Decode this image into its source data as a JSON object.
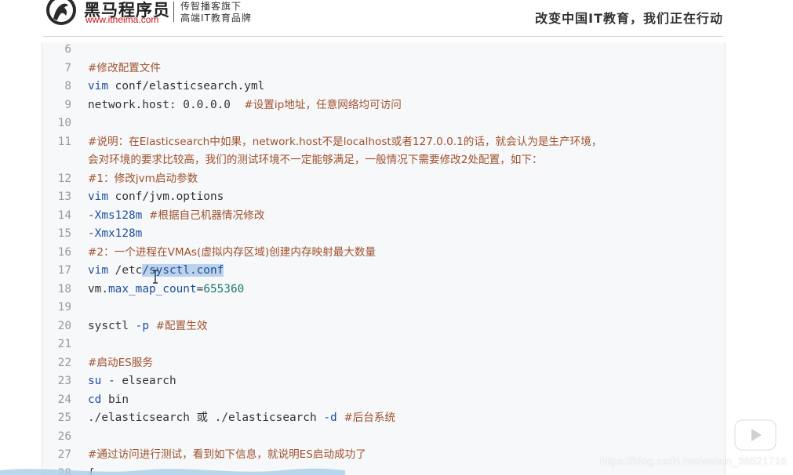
{
  "header": {
    "brand_name": "黑马程序员",
    "brand_url": "www.itheima.com",
    "tagline_1": "传智播客旗下",
    "tagline_2": "高端IT教育品牌",
    "slogan": "改变中国IT教育，我们正在行动"
  },
  "code": {
    "lines": [
      {
        "n": "6",
        "parts": []
      },
      {
        "n": "7",
        "parts": [
          {
            "t": "#修改配置文件",
            "c": "cmt"
          }
        ]
      },
      {
        "n": "8",
        "parts": [
          {
            "t": "vim",
            "c": "kw"
          },
          {
            "t": " conf/elasticsearch.yml",
            "c": "plain"
          }
        ]
      },
      {
        "n": "9",
        "parts": [
          {
            "t": "network.host: 0.0.0.0  ",
            "c": "plain"
          },
          {
            "t": "#设置ip地址，任意网络均可访问",
            "c": "cmt"
          }
        ]
      },
      {
        "n": "10",
        "parts": []
      },
      {
        "n": "11",
        "parts": [
          {
            "t": "#说明：在Elasticsearch中如果，network.host不是localhost或者127.0.0.1的话，就会认为是生产环境，",
            "c": "cmt"
          }
        ]
      },
      {
        "n": "",
        "parts": [
          {
            "t": "会对环境的要求比较高，我们的测试环境不一定能够满足，一般情况下需要修改2处配置，如下：",
            "c": "cmt"
          }
        ]
      },
      {
        "n": "12",
        "parts": [
          {
            "t": "#1：修改jvm启动参数",
            "c": "cmt"
          }
        ]
      },
      {
        "n": "13",
        "parts": [
          {
            "t": "vim",
            "c": "kw"
          },
          {
            "t": " conf/jvm.options",
            "c": "plain"
          }
        ]
      },
      {
        "n": "14",
        "parts": [
          {
            "t": "-Xms128m",
            "c": "kw"
          },
          {
            "t": " ",
            "c": "plain"
          },
          {
            "t": "#根据自己机器情况修改",
            "c": "cmt"
          }
        ]
      },
      {
        "n": "15",
        "parts": [
          {
            "t": "-Xmx128m",
            "c": "kw"
          }
        ]
      },
      {
        "n": "16",
        "parts": [
          {
            "t": "#2：一个进程在VMAs(虚拟内存区域)创建内存映射最大数量",
            "c": "cmt"
          }
        ]
      },
      {
        "n": "17",
        "parts": [
          {
            "t": "vim",
            "c": "kw"
          },
          {
            "t": " /etc",
            "c": "plain"
          },
          {
            "t": "/sysctl.conf",
            "c": "sel"
          }
        ]
      },
      {
        "n": "18",
        "parts": [
          {
            "t": "vm.",
            "c": "plain"
          },
          {
            "t": "max_map_count",
            "c": "kw"
          },
          {
            "t": "=",
            "c": "plain"
          },
          {
            "t": "655360",
            "c": "num"
          }
        ]
      },
      {
        "n": "19",
        "parts": []
      },
      {
        "n": "20",
        "parts": [
          {
            "t": "sysctl ",
            "c": "plain"
          },
          {
            "t": "-p",
            "c": "kw"
          },
          {
            "t": " ",
            "c": "plain"
          },
          {
            "t": "#配置生效",
            "c": "cmt"
          }
        ]
      },
      {
        "n": "21",
        "parts": []
      },
      {
        "n": "22",
        "parts": [
          {
            "t": "#启动ES服务",
            "c": "cmt"
          }
        ]
      },
      {
        "n": "23",
        "parts": [
          {
            "t": "su",
            "c": "kw"
          },
          {
            "t": " - elsearch",
            "c": "plain"
          }
        ]
      },
      {
        "n": "24",
        "parts": [
          {
            "t": "cd",
            "c": "kw"
          },
          {
            "t": " bin",
            "c": "plain"
          }
        ]
      },
      {
        "n": "25",
        "parts": [
          {
            "t": "./elasticsearch 或 ./elasticsearch ",
            "c": "plain"
          },
          {
            "t": "-d",
            "c": "kw"
          },
          {
            "t": " ",
            "c": "plain"
          },
          {
            "t": "#后台系统",
            "c": "cmt"
          }
        ]
      },
      {
        "n": "26",
        "parts": []
      },
      {
        "n": "27",
        "parts": [
          {
            "t": "#通过访问进行测试，看到如下信息，就说明ES启动成功了",
            "c": "cmt"
          }
        ]
      },
      {
        "n": "28",
        "parts": [
          {
            "t": "{",
            "c": "plain"
          }
        ]
      }
    ]
  },
  "watermark": "https://blog.csdn.net/weixin_36521716",
  "icons": {
    "logo": "horse-logo-icon",
    "tv": "bilibili-tv-icon",
    "cursor": "text-cursor-icon"
  },
  "colors": {
    "comment": "#a0522d",
    "keyword": "#1f4e9c",
    "number": "#1e7a6d",
    "selection": "#bcd2ea",
    "code_bg": "#f6f8fa"
  }
}
